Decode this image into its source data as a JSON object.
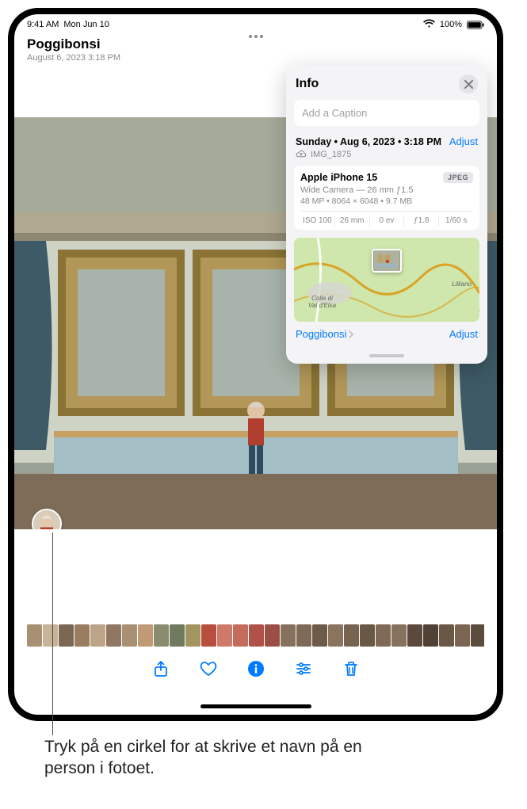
{
  "status": {
    "time": "9:41 AM",
    "date": "Mon Jun 10",
    "wifi": "wifi-icon",
    "battery": "100%"
  },
  "header": {
    "title": "Poggibonsi",
    "subtitle": "August 6, 2023 3:18 PM"
  },
  "info_panel": {
    "title": "Info",
    "caption_placeholder": "Add a Caption",
    "date_line": "Sunday • Aug 6, 2023 • 3:18 PM",
    "adjust_label": "Adjust",
    "filename": "IMG_1875",
    "device": "Apple iPhone 15",
    "format_badge": "JPEG",
    "lens": "Wide Camera — 26 mm ƒ1.5",
    "specs": "48 MP • 8064 × 6048 • 9.7 MB",
    "exif": {
      "iso": "ISO 100",
      "focal": "26 mm",
      "ev": "0 ev",
      "aperture": "ƒ1.6",
      "shutter": "1/60 s"
    },
    "map": {
      "location": "Poggibonsi",
      "label_a": "Colle di\nVal d'Elsa",
      "label_b": "Lilliano",
      "adjust_label": "Adjust"
    }
  },
  "toolbar": {
    "share": "share-icon",
    "favorite": "heart-icon",
    "info": "info-icon",
    "filters": "sliders-icon",
    "trash": "trash-icon"
  },
  "caption_text": "Tryk på en cirkel for at skrive et navn på en person i fotoet.",
  "thumb_colors": [
    "#a98f74",
    "#c6b398",
    "#7a6854",
    "#9a7c60",
    "#bda489",
    "#8f7761",
    "#a98f74",
    "#c09a75",
    "#8a8c6f",
    "#6f7a5f",
    "#a3955f",
    "#b84e3e",
    "#d0796a",
    "#c36c5a",
    "#b0524a",
    "#9b4e44",
    "#85715d",
    "#7e6a56",
    "#6e5a48",
    "#8a745e",
    "#776450",
    "#6a5846",
    "#7e6a56",
    "#86715c",
    "#5b4a3c",
    "#4f4136",
    "#6a5846",
    "#7a6452",
    "#5c4c3e",
    "#4b3e34",
    "#5b4a3c"
  ]
}
